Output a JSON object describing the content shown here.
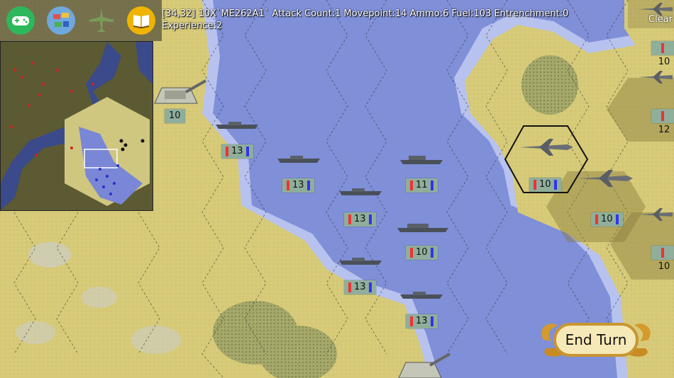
{
  "toolbar": {
    "icons": [
      "gamepad-icon",
      "flags-icon",
      "plane-icon",
      "book-icon"
    ]
  },
  "status": {
    "line1": "[34,32] 10X`ME262A1` Attack Count:1 Movepoint:14 Ammo:6 Fuel:103 Entrenchment:0",
    "line2": "Experience:2"
  },
  "weather_label": "Clear",
  "units": [
    {
      "id": "artillery-left",
      "type": "artillery",
      "strength": "10"
    },
    {
      "id": "ship-1",
      "type": "ship",
      "strength": "13"
    },
    {
      "id": "ship-2",
      "type": "ship",
      "strength": "13"
    },
    {
      "id": "ship-3",
      "type": "ship",
      "strength": "11"
    },
    {
      "id": "ship-4",
      "type": "ship",
      "strength": "13"
    },
    {
      "id": "ship-5",
      "type": "ship",
      "strength": "10"
    },
    {
      "id": "ship-6",
      "type": "ship",
      "strength": "13"
    },
    {
      "id": "ship-7",
      "type": "ship",
      "strength": "13"
    },
    {
      "id": "jet-selected",
      "type": "jet",
      "strength": "10"
    },
    {
      "id": "jet-2",
      "type": "jet",
      "strength": "10"
    },
    {
      "id": "jet-right-1",
      "type": "jet",
      "strength": "10"
    },
    {
      "id": "jet-right-2",
      "type": "jet",
      "strength": "12"
    },
    {
      "id": "jet-right-3",
      "type": "jet",
      "strength": "10"
    }
  ],
  "end_turn": {
    "label": "End Turn"
  },
  "colors": {
    "sea": "#7f8fd8",
    "land": "#d8cc7a",
    "shore": "#b8c2ee",
    "forest": "#8f9a5a"
  }
}
